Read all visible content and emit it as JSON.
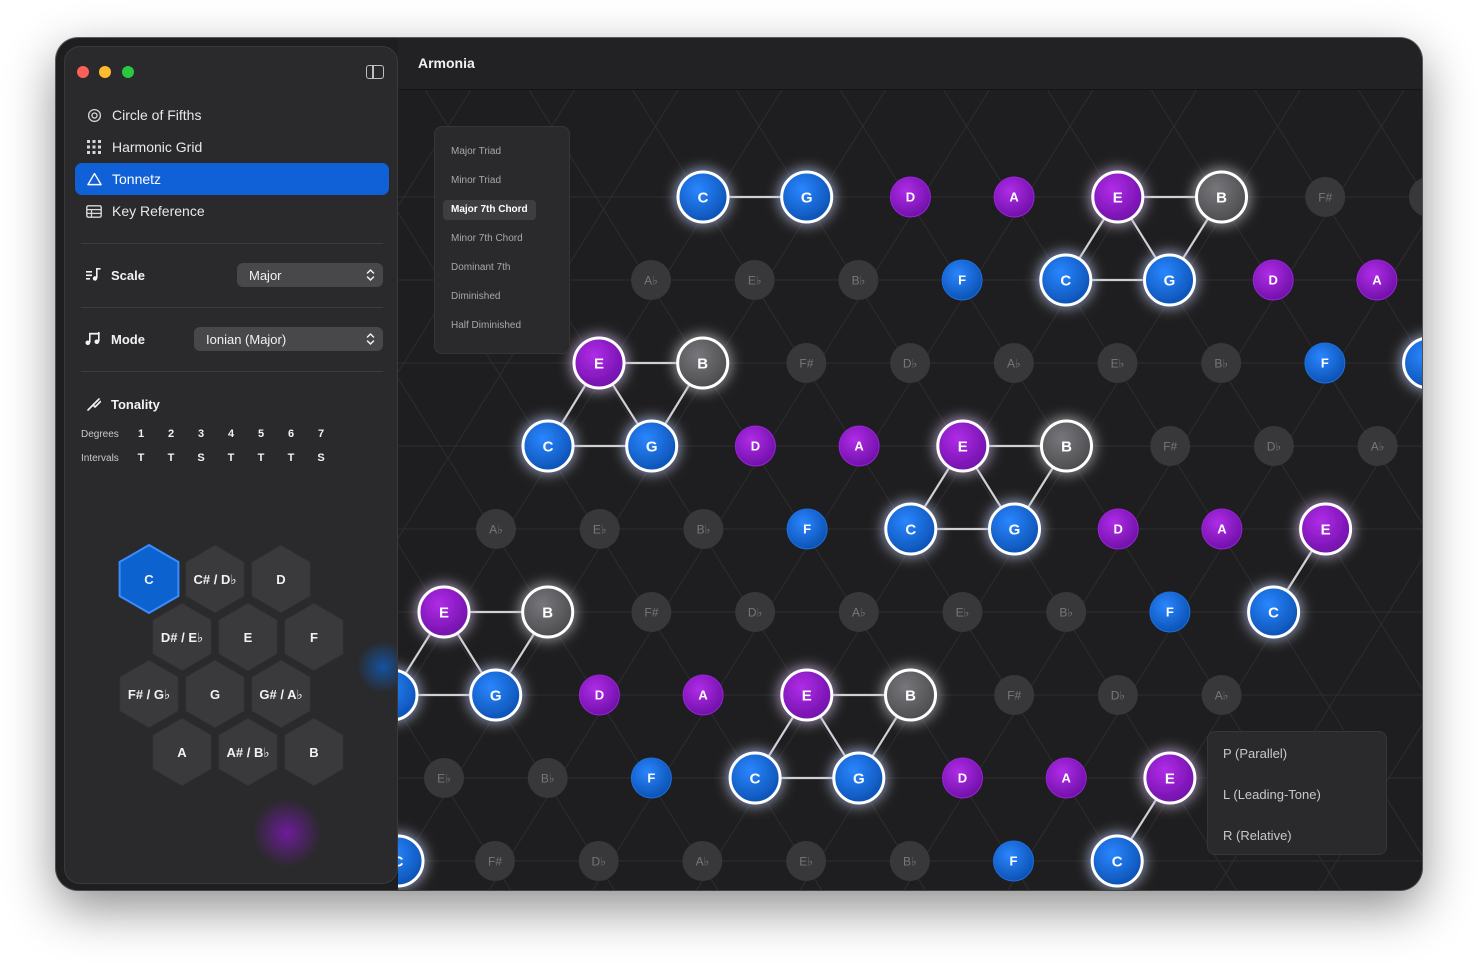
{
  "app": {
    "title": "Armonia"
  },
  "sidebar": {
    "nav": [
      {
        "label": "Circle of Fifths",
        "icon": "target-icon"
      },
      {
        "label": "Harmonic Grid",
        "icon": "grid-icon"
      },
      {
        "label": "Tonnetz",
        "icon": "triangle-icon",
        "active": true
      },
      {
        "label": "Key Reference",
        "icon": "table-icon"
      }
    ],
    "scale": {
      "label": "Scale",
      "value": "Major"
    },
    "mode": {
      "label": "Mode",
      "value": "Ionian (Major)"
    },
    "tonality": {
      "label": "Tonality",
      "degrees_label": "Degrees",
      "intervals_label": "Intervals",
      "degrees": [
        "1",
        "2",
        "3",
        "4",
        "5",
        "6",
        "7"
      ],
      "intervals": [
        "T",
        "T",
        "S",
        "T",
        "T",
        "T",
        "S"
      ]
    },
    "keys": [
      {
        "label": "C",
        "selected": true
      },
      {
        "label": "C# / D♭"
      },
      {
        "label": "D"
      },
      {
        "label": "D# / E♭"
      },
      {
        "label": "E"
      },
      {
        "label": "F"
      },
      {
        "label": "F# / G♭"
      },
      {
        "label": "G"
      },
      {
        "label": "G# / A♭"
      },
      {
        "label": "A"
      },
      {
        "label": "A# / B♭"
      },
      {
        "label": "B"
      }
    ]
  },
  "chords": {
    "items": [
      "Major Triad",
      "Minor Triad",
      "Major 7th Chord",
      "Minor 7th Chord",
      "Dominant 7th",
      "Diminished",
      "Half Diminished"
    ],
    "selected": "Major 7th Chord"
  },
  "transforms": [
    "P (Parallel)",
    "L (Leading-Tone)",
    "R (Relative)"
  ],
  "tonnetz": {
    "colors": {
      "blue": "#0c63cf",
      "purple": "#8a16c8",
      "gray": "#59595c",
      "dim": "#38383b"
    },
    "rows": [
      {
        "notes": [
          "C",
          "G",
          "D",
          "A",
          "E",
          "B",
          "F#",
          "C#"
        ],
        "states": [
          "chordBlue",
          "chordBlue",
          "purple",
          "purple",
          "chordPurple",
          "chordGray",
          "dim",
          "dim"
        ]
      },
      {
        "notes": [
          "A♭",
          "E♭",
          "B♭",
          "F",
          "C",
          "G",
          "D",
          "A"
        ],
        "states": [
          "dim",
          "dim",
          "dim",
          "blue",
          "chordBlue",
          "chordBlue",
          "purple",
          "purple"
        ]
      },
      {
        "notes": [
          "E",
          "B",
          "F#",
          "D♭",
          "A♭",
          "E♭",
          "B♭",
          "F",
          "C"
        ],
        "states": [
          "chordPurple",
          "chordGray",
          "dim",
          "dim",
          "dim",
          "dim",
          "dim",
          "blue",
          "chordBlue"
        ]
      },
      {
        "notes": [
          "C",
          "G",
          "D",
          "A",
          "E",
          "B",
          "F#",
          "D♭",
          "A♭"
        ],
        "states": [
          "chordBlue",
          "chordBlue",
          "purple",
          "purple",
          "chordPurple",
          "chordGray",
          "dim",
          "dim",
          "dim"
        ]
      },
      {
        "notes": [
          "A♭",
          "E♭",
          "B♭",
          "F",
          "C",
          "G",
          "D",
          "A",
          "E"
        ],
        "states": [
          "dim",
          "dim",
          "dim",
          "blue",
          "chordBlue",
          "chordBlue",
          "purple",
          "purple",
          "chordPurple"
        ]
      },
      {
        "notes": [
          "E",
          "B",
          "F#",
          "D♭",
          "A♭",
          "E♭",
          "B♭",
          "F",
          "C"
        ],
        "states": [
          "chordPurple",
          "chordGray",
          "dim",
          "dim",
          "dim",
          "dim",
          "dim",
          "blue",
          "chordBlue"
        ]
      },
      {
        "notes": [
          "C",
          "G",
          "D",
          "A",
          "E",
          "B",
          "F#",
          "D♭",
          "A♭"
        ],
        "states": [
          "chordBlue",
          "chordBlue",
          "purple",
          "purple",
          "chordPurple",
          "chordGray",
          "dim",
          "dim",
          "dim"
        ]
      },
      {
        "notes": [
          "E♭",
          "B♭",
          "F",
          "C",
          "G",
          "D",
          "A",
          "E"
        ],
        "states": [
          "dim",
          "dim",
          "blue",
          "chordBlue",
          "chordBlue",
          "purple",
          "purple",
          "chordPurple"
        ]
      },
      {
        "notes": [
          "C",
          "F#",
          "D♭",
          "A♭",
          "E♭",
          "B♭",
          "F",
          "C"
        ],
        "states": [
          "chordBlue",
          "dim",
          "dim",
          "dim",
          "dim",
          "dim",
          "blue",
          "chordBlue"
        ]
      }
    ]
  }
}
